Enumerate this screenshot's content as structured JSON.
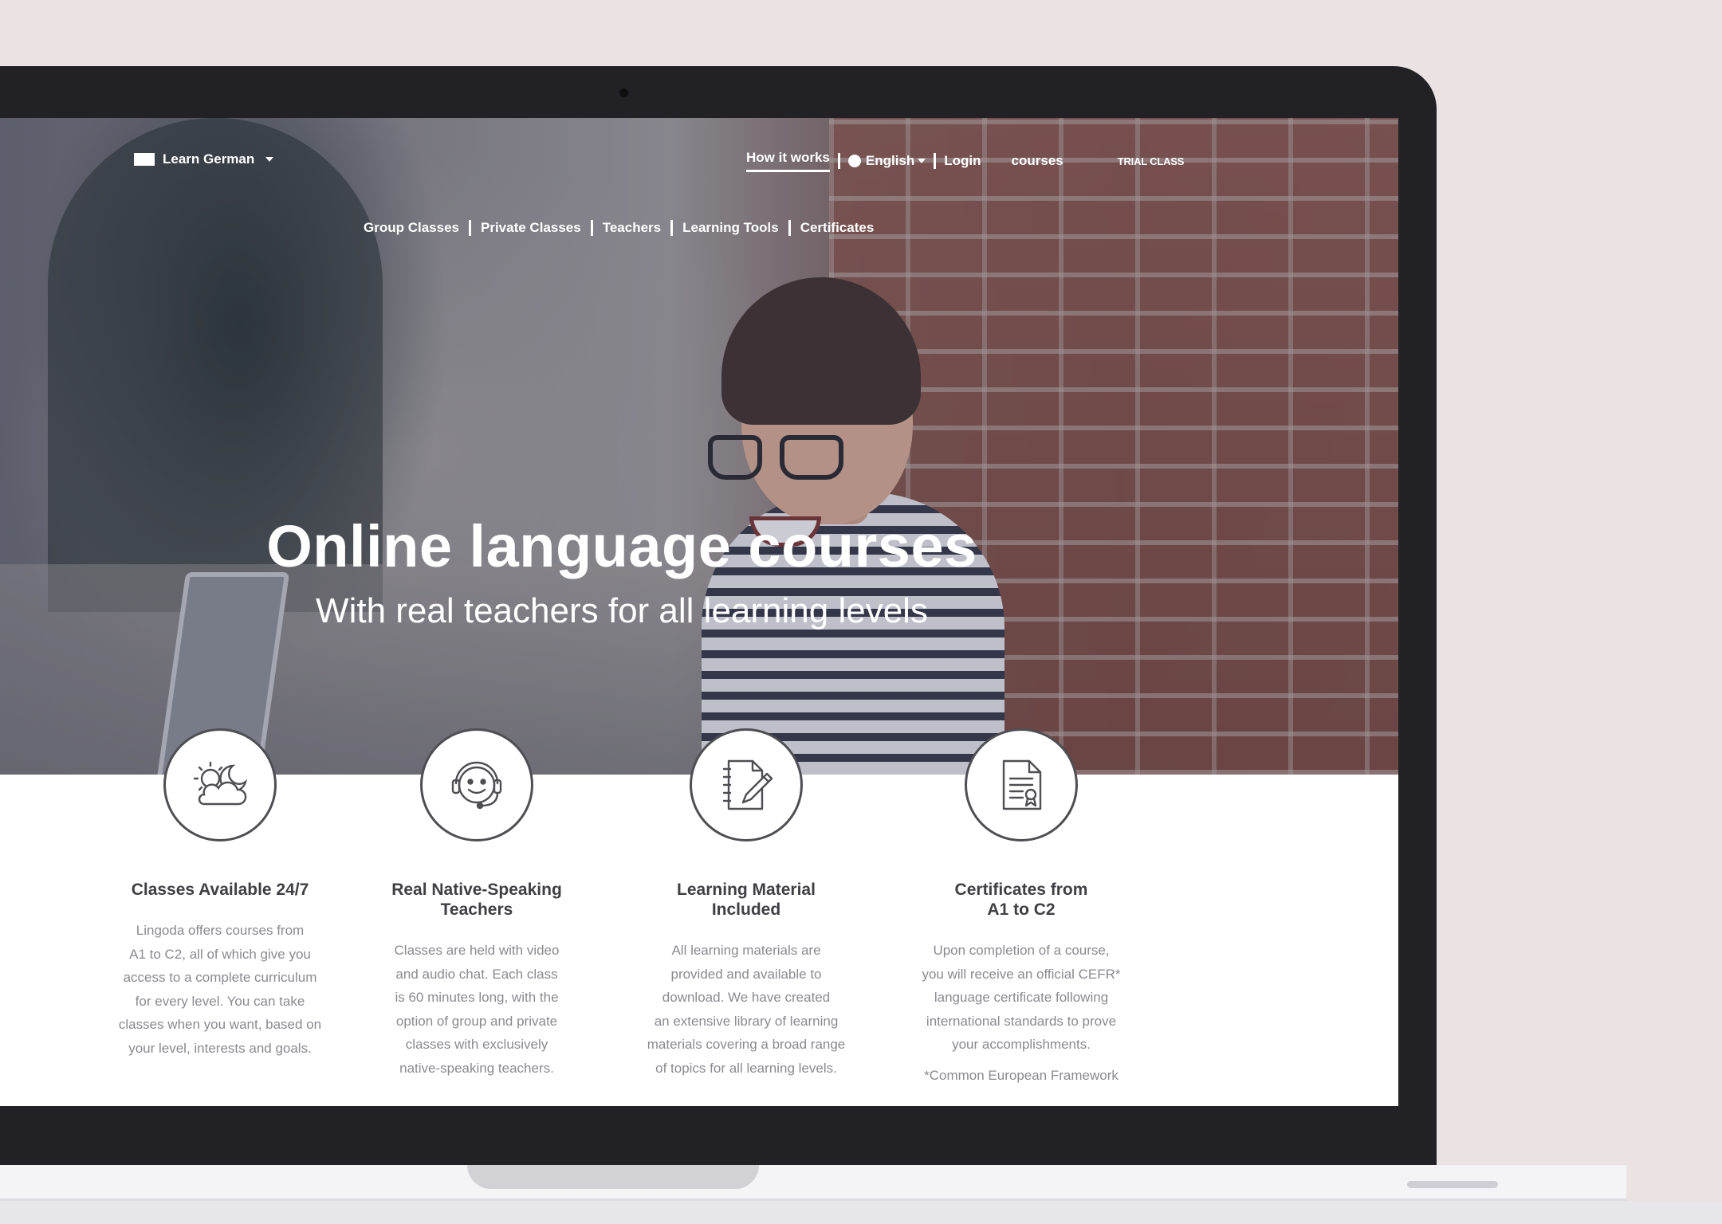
{
  "nav": {
    "brand_label": "Learn German",
    "how_it_works": "How it works",
    "language": "English",
    "login": "Login",
    "courses": "courses",
    "trial_class": "TRIAL CLASS"
  },
  "sub_nav": {
    "items": [
      "Group Classes",
      "Private Classes",
      "Teachers",
      "Learning Tools",
      "Certificates"
    ]
  },
  "hero": {
    "title": "Online language courses",
    "subtitle": "With real teachers for all learning levels"
  },
  "features": [
    {
      "icon": "day-night-icon",
      "title_lines": [
        "Classes Available 24/7"
      ],
      "body_lines": [
        "Lingoda offers courses from",
        "A1 to C2, all of which give you",
        "access to a complete curriculum",
        "for every level. You can take",
        "classes when you want, based on",
        "your level, interests and goals."
      ]
    },
    {
      "icon": "headset-teacher-icon",
      "title_lines": [
        "Real Native-Speaking",
        "Teachers"
      ],
      "body_lines": [
        "Classes are held with video",
        "and audio chat. Each class",
        "is 60 minutes long, with the",
        "option of group and private",
        "classes with exclusively",
        "native-speaking teachers."
      ]
    },
    {
      "icon": "notebook-pencil-icon",
      "title_lines": [
        "Learning Material",
        "Included"
      ],
      "body_lines": [
        "All learning materials are",
        "provided and available to",
        "download. We have created",
        "an extensive library of learning",
        "materials covering a broad range",
        "of topics for all learning levels."
      ]
    },
    {
      "icon": "certificate-icon",
      "title_lines": [
        "Certificates from",
        "A1 to C2"
      ],
      "body_lines": [
        "Upon completion of a course,",
        "you will receive an official CEFR*",
        "language certificate following",
        "international standards to prove",
        "your accomplishments."
      ],
      "footnote": "*Common European Framework"
    }
  ],
  "colors": {
    "background": "#ebe3e3",
    "laptop_bezel": "#222226",
    "heading_text": "#3f3f44",
    "body_text": "#8a8a90"
  }
}
